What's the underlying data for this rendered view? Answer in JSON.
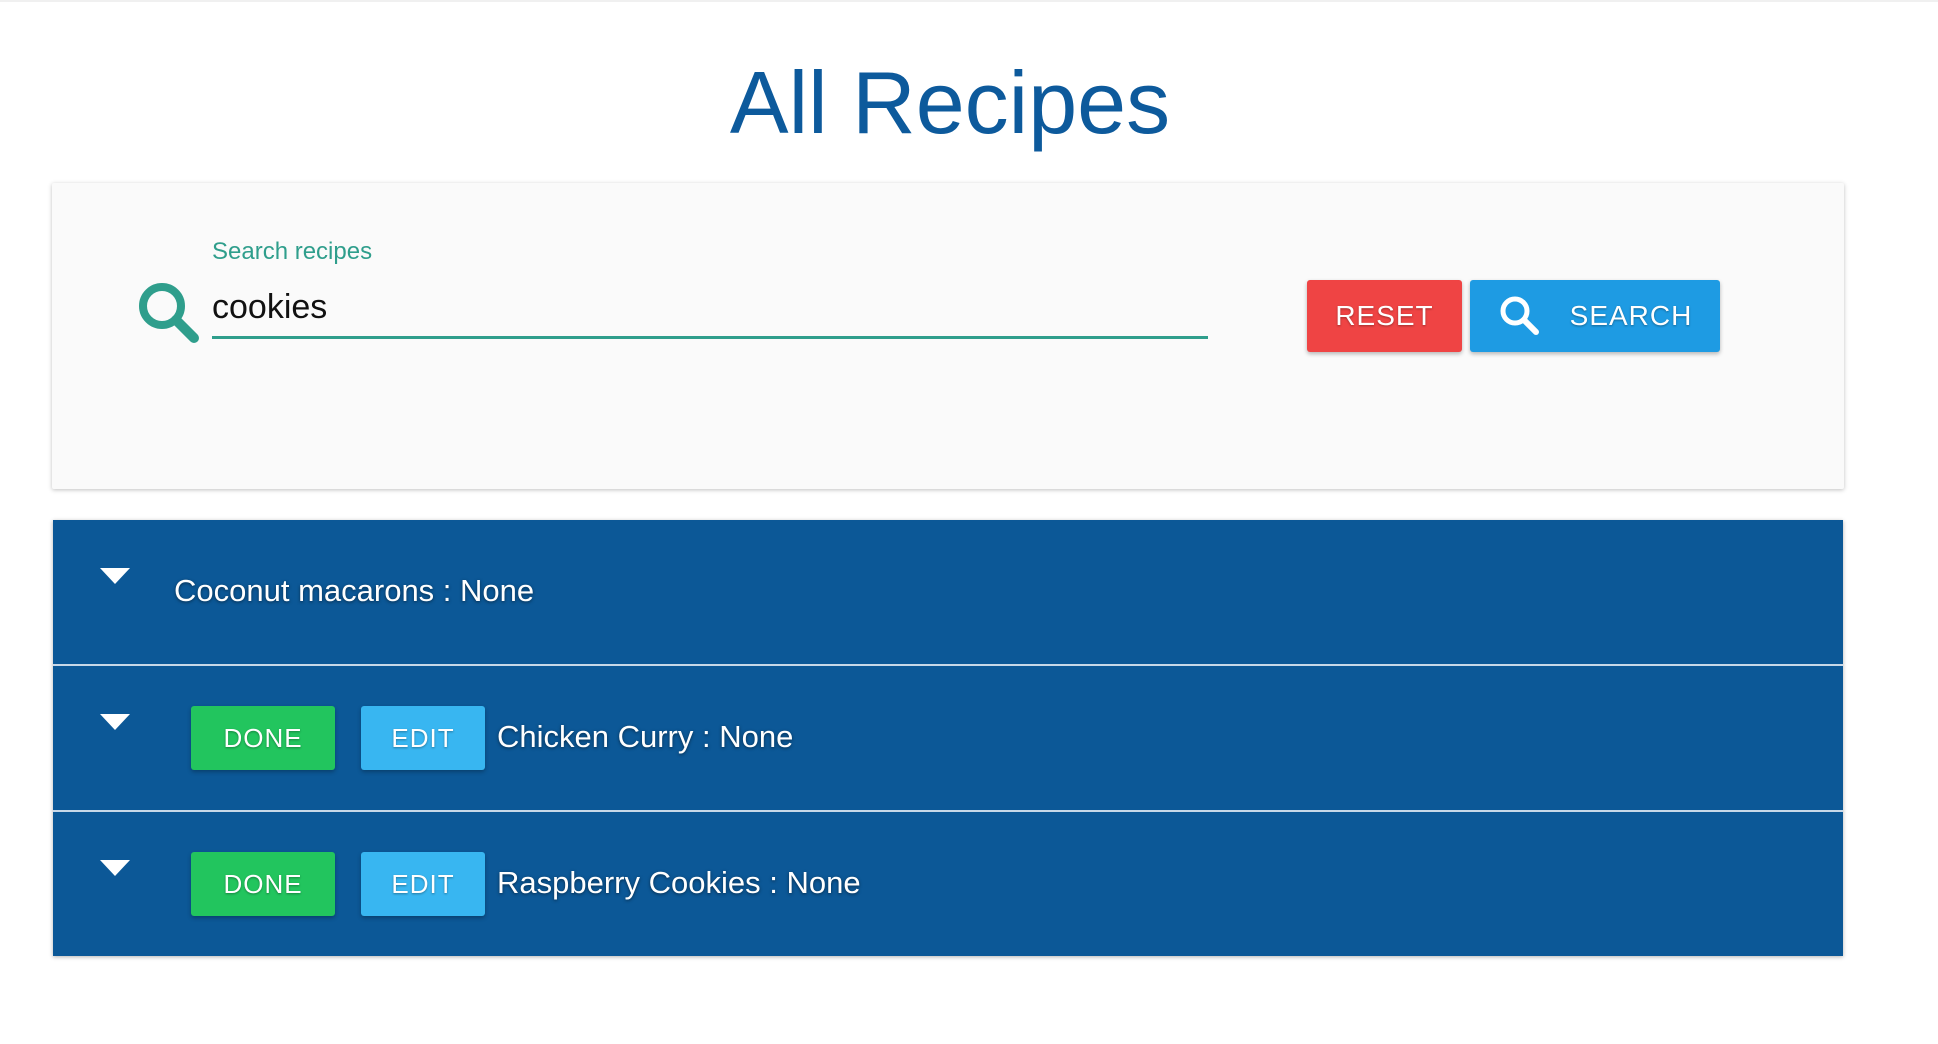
{
  "page": {
    "title": "All Recipes"
  },
  "search": {
    "label": "Search recipes",
    "value": "cookies",
    "reset_label": "RESET",
    "search_label": "SEARCH"
  },
  "recipes": [
    {
      "name": "Coconut macarons : None",
      "done_label": "",
      "edit_label": ""
    },
    {
      "name": "Chicken Curry : None",
      "done_label": "DONE",
      "edit_label": "EDIT"
    },
    {
      "name": "Raspberry Cookies : None",
      "done_label": "DONE",
      "edit_label": "EDIT"
    }
  ],
  "colors": {
    "title": "#0d5a9c",
    "accent": "#2f9e8c",
    "reset": "#ef4444",
    "search": "#1e9be3",
    "list_bg": "#0c5897",
    "done": "#22c55e",
    "edit": "#38b6f1"
  },
  "icons": {
    "search_field": "search-icon",
    "search_button": "search-icon",
    "row_toggle": "caret-down-icon"
  }
}
